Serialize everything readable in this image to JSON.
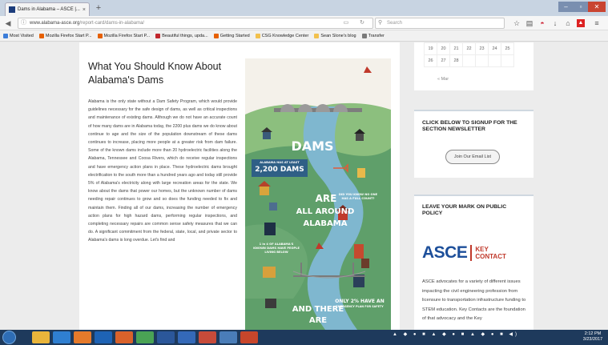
{
  "browser": {
    "tab_title": "Dams in Alabama – ASCE |...",
    "tab_close": "×",
    "new_tab": "+",
    "url_domain": "www.alabama-asce.org",
    "url_path": "/report-card/dams-in-alabama/",
    "search_placeholder": "Search",
    "bookmarks": [
      {
        "label": "Most Visited",
        "color": "#3c7dd9"
      },
      {
        "label": "Mozilla Firefox Start P...",
        "color": "#e66000"
      },
      {
        "label": "Mozilla Firefox Start P...",
        "color": "#e66000"
      },
      {
        "label": "Beautiful things, upda...",
        "color": "#c1272d"
      },
      {
        "label": "Getting Started",
        "color": "#e66000"
      },
      {
        "label": "CSG Knowledge Center",
        "color": "#f2c14e"
      },
      {
        "label": "Sean Slone's blog",
        "color": "#f2c14e"
      },
      {
        "label": "Transfer",
        "color": "#7a7a7a"
      }
    ]
  },
  "article": {
    "title": "What You Should Know About Alabama's Dams",
    "body": "Alabama is the only state without a Dam Safety Program, which would provide guidelines necessary for the safe design of dams, as well as critical inspections and maintenance of existing dams. Although we do not have an accurate count of how many dams are in Alabama today, the 2200 plus dams we do know about continue to age and the size of the population downstream of these dams continues to increase, placing more people at a greater risk from dam failure. Some of the known dams include more than 20 hydroelectric facilities along the Alabama, Tennessee and Coosa Rivers, which do receive regular inspections and have emergency action plans in place. These hydroelectric dams brought electrification to the south more than a hundred years ago and today still provide 5% of Alabama's electricity along with large recreation areas for the state. We know about the dams that power our homes, but the unknown number of dams needing repair continues to grow and so does the funding needed to fix and maintain them. Finding all of our dams, increasing the number of emergency action plans for high hazard dams, performing regular inspections, and completing necessary repairs are common sense safety measures that we can do. A significant commitment from the federal, state, local, and private sector to Alabama's dams is long overdue. Let's find and"
  },
  "infographic": {
    "dams": "DAMS",
    "banner_small": "ALABAMA HAS AT LEAST",
    "banner_big": "2,200 DAMS",
    "are": "ARE",
    "all_around": "ALL AROUND",
    "alabama": "ALABAMA",
    "question": "DID YOU KNOW NO ONE HAS A FULL COUNT?",
    "one_in_four": "1 in 4 OF ALABAMA'S KNOWN DAMS HAVE PEOPLE LIVING BELOW",
    "only_pct": "ONLY 2% HAVE AN",
    "emergency": "EMERGENCY PLAN FOR SAFETY",
    "and_there": "AND THERE",
    "are2": "ARE"
  },
  "sidebar": {
    "calendar": {
      "rows": [
        [
          "19",
          "20",
          "21",
          "22",
          "23",
          "24",
          "25"
        ],
        [
          "26",
          "27",
          "28",
          "",
          "",
          "",
          ""
        ]
      ],
      "prev_link": "« Mar"
    },
    "newsletter_title": "CLICK BELOW TO SIGNUP FOR THE SECTION NEWSLETTER",
    "join_button": "Join Our Email List",
    "policy_title": "LEAVE YOUR MARK ON PUBLIC POLICY",
    "logo_word": "ASCE",
    "logo_key": "KEY",
    "logo_contact": "CONTACT",
    "policy_text": "ASCE advocates for a variety of different issues impacting the civil engineering profession from licensure to transportation infrastructure funding to STEM education. Key Contacts are the foundation of that advocacy and the Key"
  },
  "taskbar": {
    "time": "2:12 PM",
    "date": "3/23/2017",
    "apps": [
      {
        "icon": "explorer-icon",
        "color": "#e9b53b"
      },
      {
        "icon": "ie-icon",
        "color": "#2f7fd1"
      },
      {
        "icon": "media-player-icon",
        "color": "#e57a2b"
      },
      {
        "icon": "outlook-icon",
        "color": "#1e63b5"
      },
      {
        "icon": "firefox-icon",
        "color": "#d9622b"
      },
      {
        "icon": "chrome-icon",
        "color": "#4aa355"
      },
      {
        "icon": "word-icon",
        "color": "#2b579a"
      },
      {
        "icon": "word-doc-icon",
        "color": "#3469b8"
      },
      {
        "icon": "chrome-alt-icon",
        "color": "#c74b3a"
      },
      {
        "icon": "network-icon",
        "color": "#4a7db8"
      },
      {
        "icon": "powerpoint-icon",
        "color": "#c8462b"
      }
    ]
  }
}
